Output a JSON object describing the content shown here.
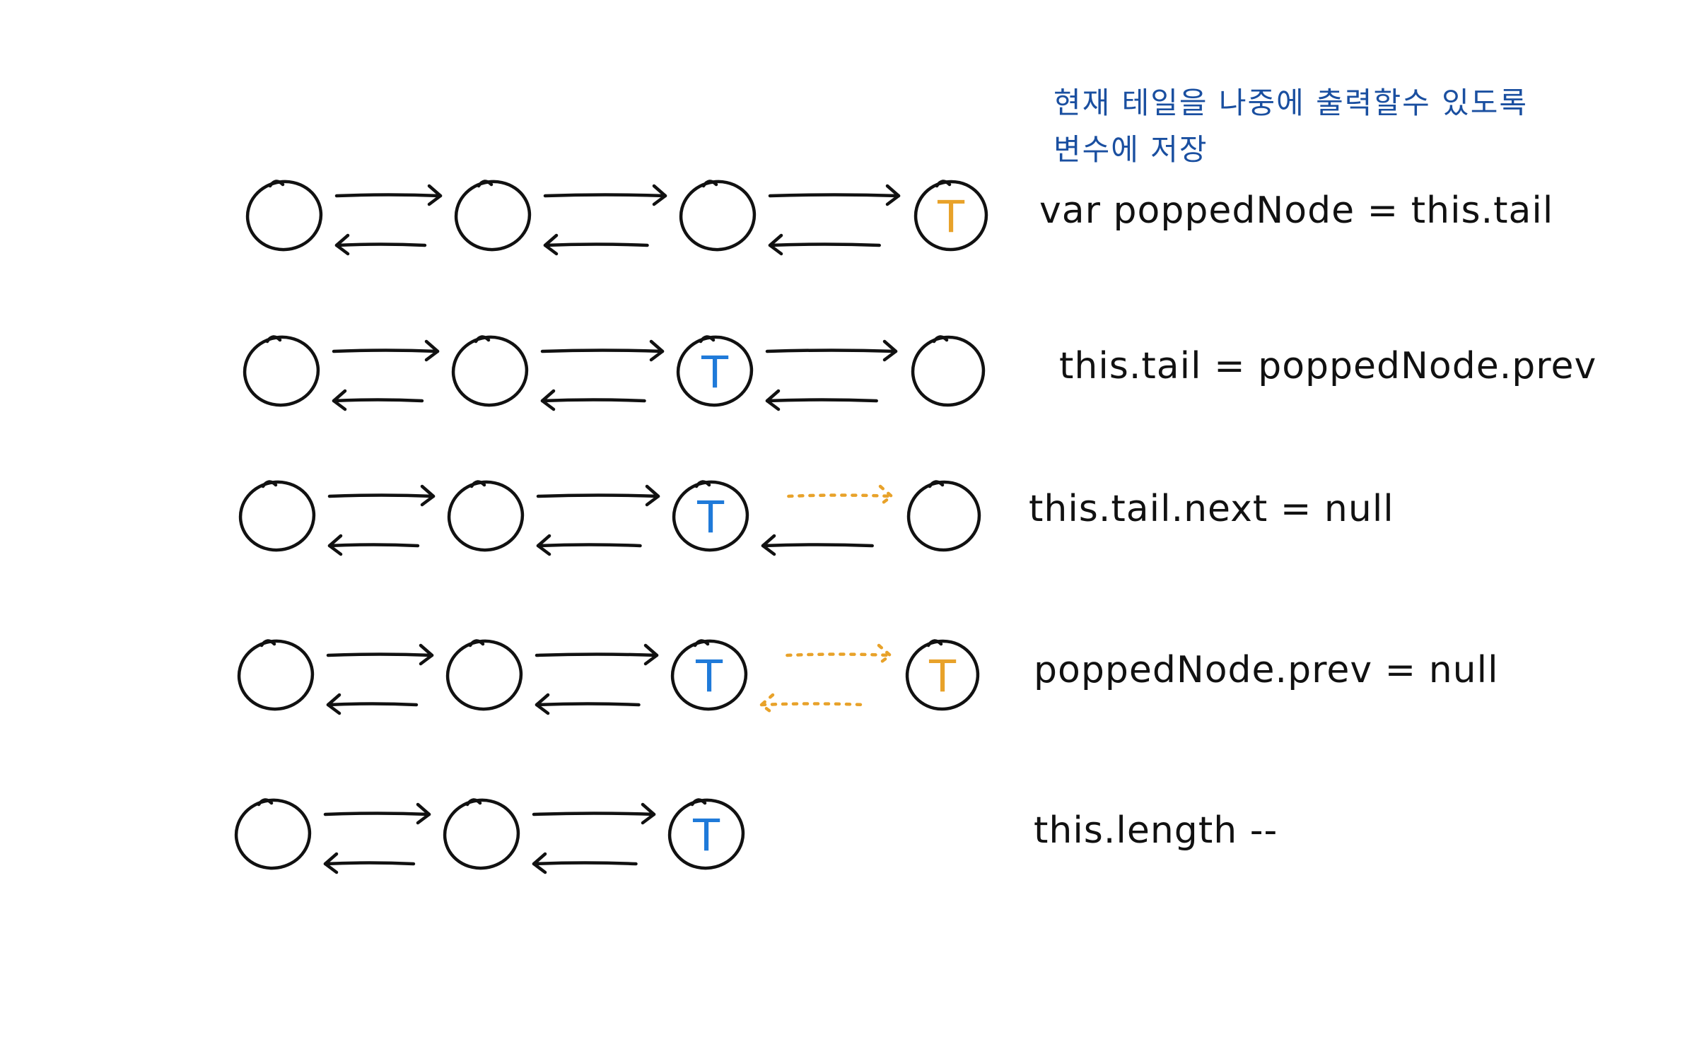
{
  "colors": {
    "ink": "#111111",
    "tail_current": "#1f7ad9",
    "tail_popped": "#e8a22a",
    "note": "#1a4fa0"
  },
  "note": {
    "line1": "현재 테일을 나중에 출력할수 있도록",
    "line2": "변수에 저장"
  },
  "tail_label": "T",
  "steps": [
    {
      "code": "var poppedNode = this.tail",
      "nodes": [
        "plain",
        "plain",
        "plain",
        "tail-popped"
      ],
      "links": [
        {
          "next": "solid",
          "prev": "solid"
        },
        {
          "next": "solid",
          "prev": "solid"
        },
        {
          "next": "solid",
          "prev": "solid"
        }
      ]
    },
    {
      "code": "this.tail = poppedNode.prev",
      "nodes": [
        "plain",
        "plain",
        "tail-current",
        "plain"
      ],
      "links": [
        {
          "next": "solid",
          "prev": "solid"
        },
        {
          "next": "solid",
          "prev": "solid"
        },
        {
          "next": "solid",
          "prev": "solid"
        }
      ]
    },
    {
      "code": "this.tail.next = null",
      "nodes": [
        "plain",
        "plain",
        "tail-current",
        "plain"
      ],
      "links": [
        {
          "next": "solid",
          "prev": "solid"
        },
        {
          "next": "solid",
          "prev": "solid"
        },
        {
          "next": "removed",
          "prev": "solid"
        }
      ]
    },
    {
      "code": "poppedNode.prev = null",
      "nodes": [
        "plain",
        "plain",
        "tail-current",
        "tail-popped"
      ],
      "links": [
        {
          "next": "solid",
          "prev": "solid"
        },
        {
          "next": "solid",
          "prev": "solid"
        },
        {
          "next": "removed",
          "prev": "removed"
        }
      ]
    },
    {
      "code": "this.length --",
      "nodes": [
        "plain",
        "plain",
        "tail-current"
      ],
      "links": [
        {
          "next": "solid",
          "prev": "solid"
        },
        {
          "next": "solid",
          "prev": "solid"
        }
      ]
    }
  ]
}
